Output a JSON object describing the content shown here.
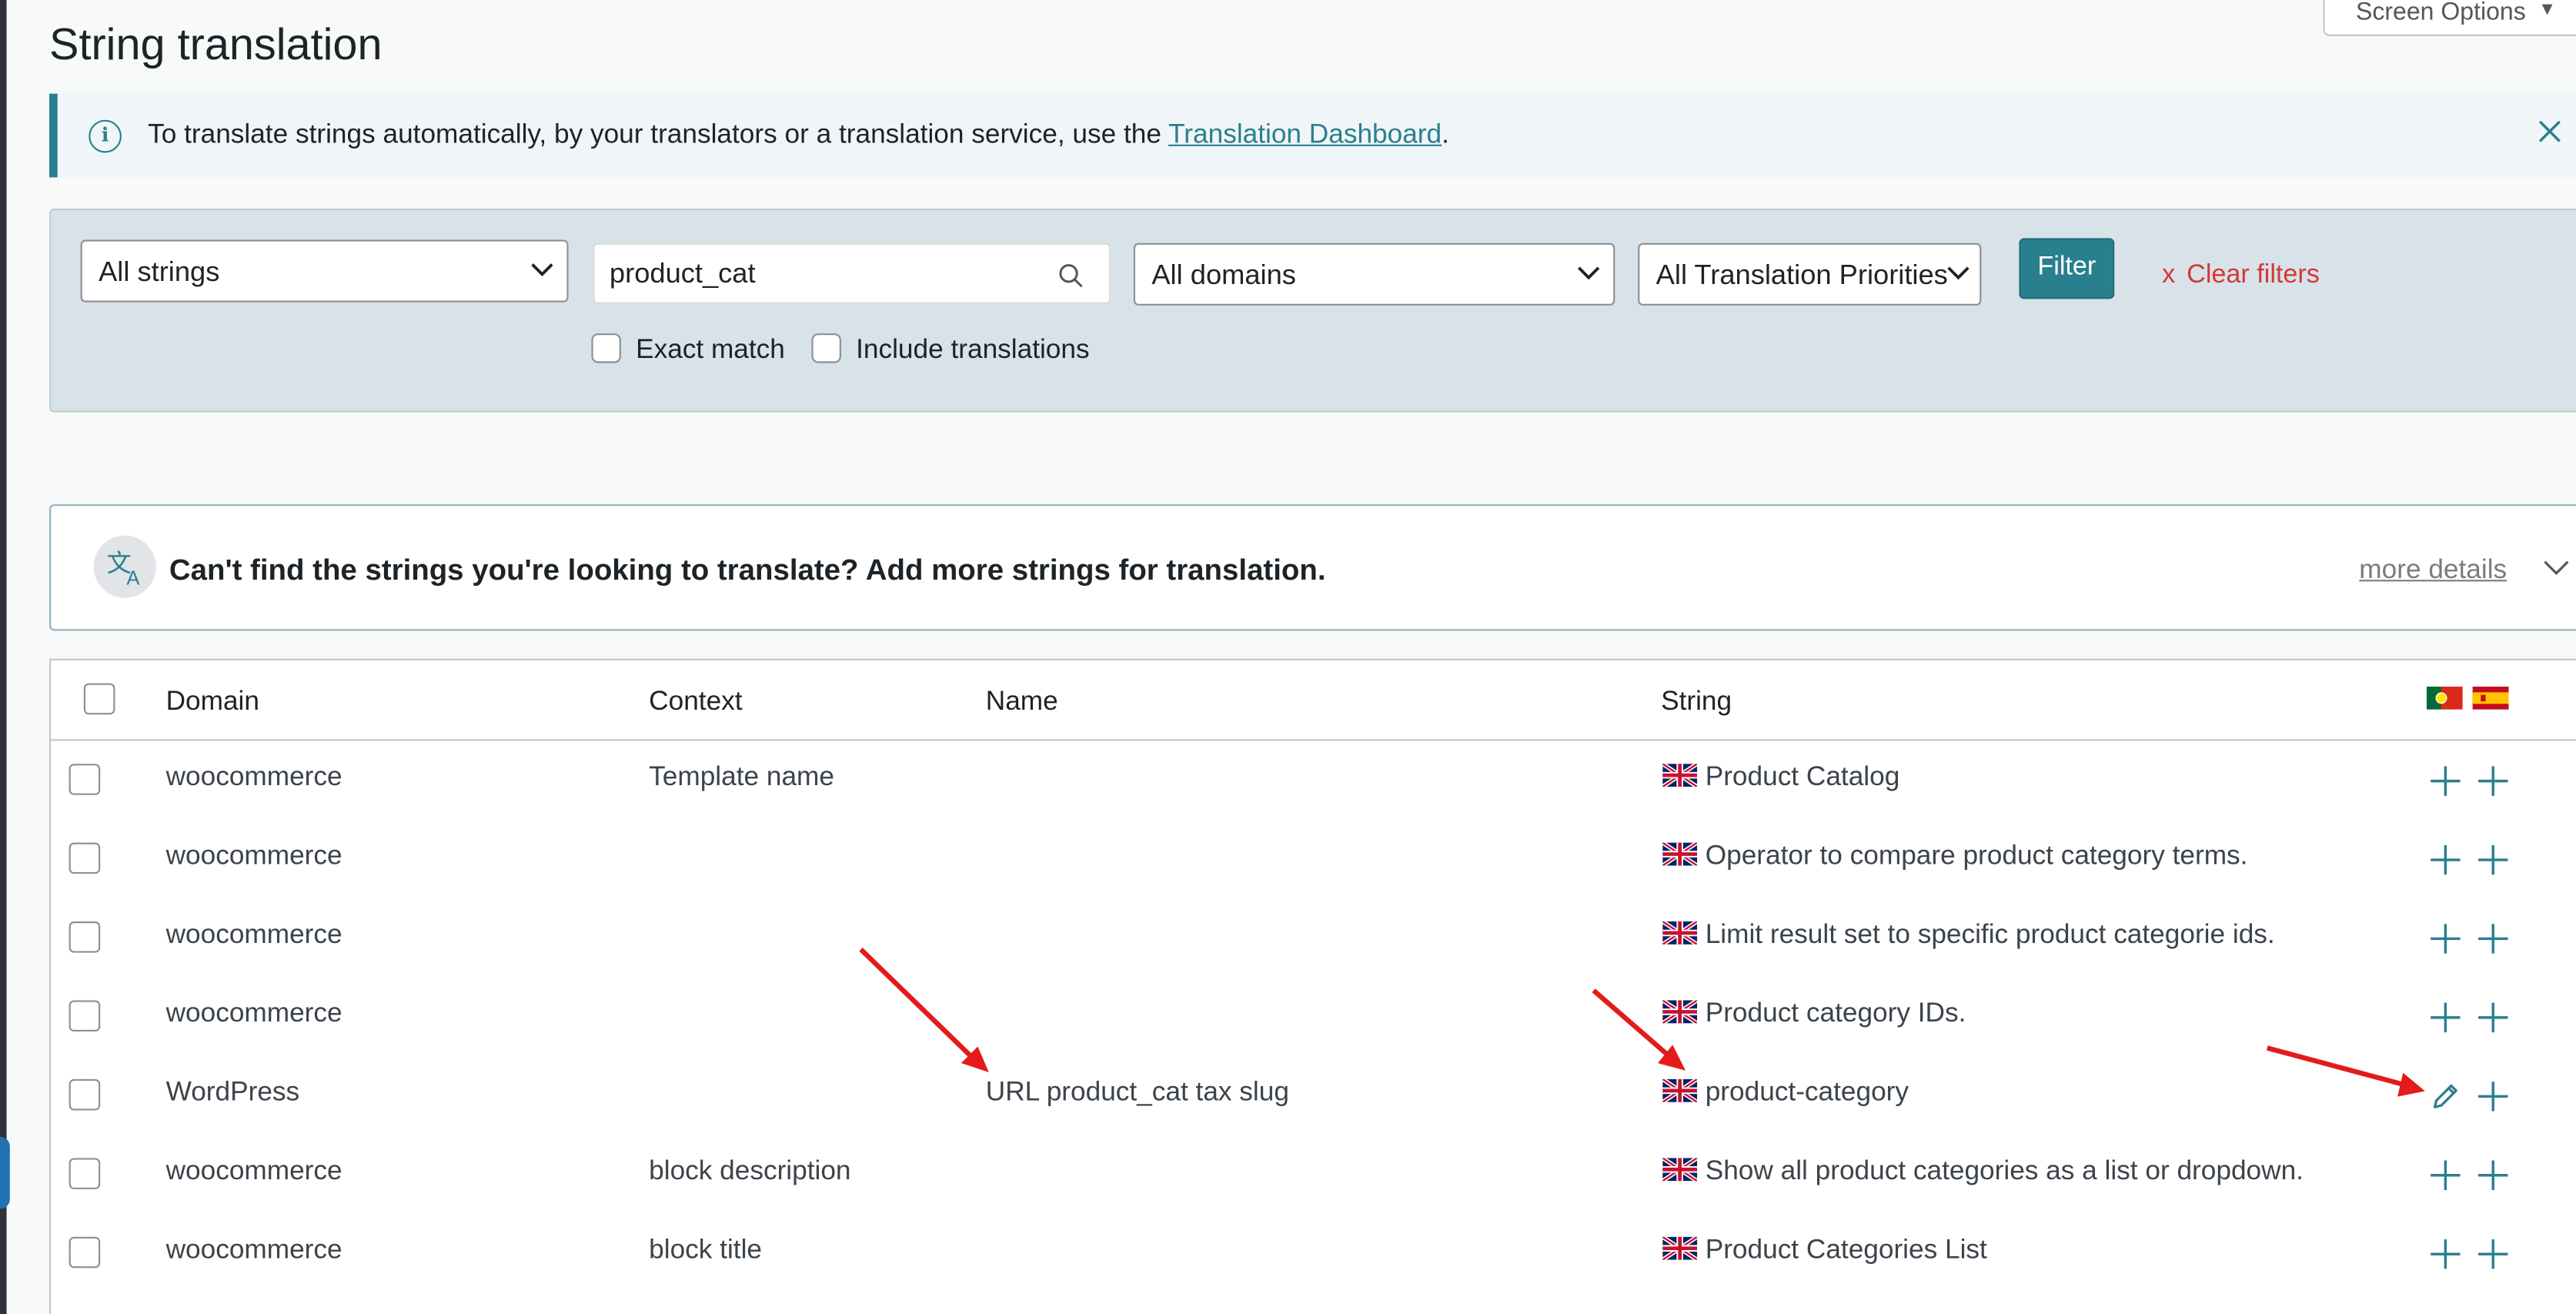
{
  "page": {
    "title": "String translation",
    "screen_options_label": "Screen Options"
  },
  "notice": {
    "text_before": "To translate strings automatically, by your translators or a translation service, use the ",
    "link_text": "Translation Dashboard",
    "text_after": ".",
    "icon": "info-icon",
    "close_icon": "close-icon"
  },
  "filters": {
    "strings_select": "All strings",
    "search_value": "product_cat",
    "domains_select": "All domains",
    "priorities_select": "All Translation Priorities",
    "filter_button": "Filter",
    "clear_filters_x": "x",
    "clear_filters_label": "Clear filters",
    "exact_match_label": "Exact match",
    "include_translations_label": "Include translations"
  },
  "add_more": {
    "headline": "Can't find the strings you're looking to translate? Add more strings for translation.",
    "more_details": "more details",
    "icon": "translate-icon"
  },
  "table": {
    "columns": {
      "domain": "Domain",
      "context": "Context",
      "name": "Name",
      "string": "String"
    },
    "language_flags": [
      "portugal-flag",
      "spain-flag"
    ],
    "rows": [
      {
        "domain": "woocommerce",
        "context": "Template name",
        "name": "",
        "string": "Product Catalog",
        "actions": [
          "add",
          "add"
        ]
      },
      {
        "domain": "woocommerce",
        "context": "",
        "name": "",
        "string": "Operator to compare product category terms.",
        "actions": [
          "add",
          "add"
        ]
      },
      {
        "domain": "woocommerce",
        "context": "",
        "name": "",
        "string": "Limit result set to specific product categorie ids.",
        "actions": [
          "add",
          "add"
        ]
      },
      {
        "domain": "woocommerce",
        "context": "",
        "name": "",
        "string": "Product category IDs.",
        "actions": [
          "add",
          "add"
        ]
      },
      {
        "domain": "WordPress",
        "context": "",
        "name": "URL product_cat tax slug",
        "string": "product-category",
        "actions": [
          "edit",
          "add"
        ]
      },
      {
        "domain": "woocommerce",
        "context": "block description",
        "name": "",
        "string": "Show all product categories as a list or dropdown.",
        "actions": [
          "add",
          "add"
        ]
      },
      {
        "domain": "woocommerce",
        "context": "block title",
        "name": "",
        "string": "Product Categories List",
        "actions": [
          "add",
          "add"
        ]
      }
    ]
  },
  "colors": {
    "accent": "#2a7f8f",
    "filter_panel_bg": "#d7e3e8",
    "clear_filters": "#d63638",
    "annotation_arrow": "#e31b1b"
  }
}
